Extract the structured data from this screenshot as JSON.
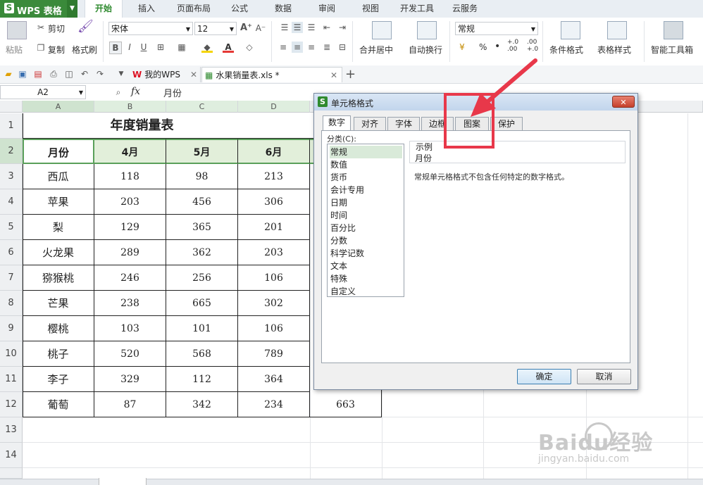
{
  "app": {
    "logo_icon": "S",
    "logo_text": "WPS 表格"
  },
  "ribbon_tabs": [
    "开始",
    "插入",
    "页面布局",
    "公式",
    "数据",
    "审阅",
    "视图",
    "开发工具",
    "云服务"
  ],
  "ribbon": {
    "paste": "粘贴",
    "cut": "剪切",
    "copy": "复制",
    "format_painter": "格式刷",
    "font_name": "宋体",
    "font_size": "12",
    "bold": "B",
    "italic": "I",
    "underline": "U",
    "merge_center": "合并居中",
    "wrap_text": "自动换行",
    "number_format": "常规",
    "percent": "%",
    "comma": "•",
    "inc_decimal": "+.0 .00",
    "dec_decimal": ".00 +.0",
    "conditional_format": "条件格式",
    "table_style": "表格样式",
    "smart_toolbox": "智能工具箱"
  },
  "doc_tabs": [
    {
      "label": "我的WPS"
    },
    {
      "label": "水果销量表.xls *"
    }
  ],
  "formula_bar": {
    "cell_ref": "A2",
    "fx": "fx",
    "value": "月份"
  },
  "sheet": {
    "columns": [
      "A",
      "B",
      "C",
      "D"
    ],
    "row_numbers": [
      "1",
      "2",
      "3",
      "4",
      "5",
      "6",
      "7",
      "8",
      "9",
      "10",
      "11",
      "12",
      "13",
      "14"
    ],
    "title": "年度销量表",
    "headers": [
      "月份",
      "4月",
      "5月",
      "6月"
    ],
    "rows": [
      [
        "西瓜",
        "118",
        "98",
        "213"
      ],
      [
        "苹果",
        "203",
        "456",
        "306"
      ],
      [
        "梨",
        "129",
        "365",
        "201"
      ],
      [
        "火龙果",
        "289",
        "362",
        "203"
      ],
      [
        "猕猴桃",
        "246",
        "256",
        "106"
      ],
      [
        "芒果",
        "238",
        "665",
        "302"
      ],
      [
        "樱桃",
        "103",
        "101",
        "106"
      ],
      [
        "桃子",
        "520",
        "568",
        "789"
      ],
      [
        "李子",
        "329",
        "112",
        "364"
      ],
      [
        "葡萄",
        "87",
        "342",
        "234",
        "663"
      ]
    ]
  },
  "dialog": {
    "icon": "S",
    "title": "单元格格式",
    "close": "✕",
    "tabs": [
      "数字",
      "对齐",
      "字体",
      "边框",
      "图案",
      "保护"
    ],
    "category_label": "分类(C):",
    "categories": [
      "常规",
      "数值",
      "货币",
      "会计专用",
      "日期",
      "时间",
      "百分比",
      "分数",
      "科学记数",
      "文本",
      "特殊",
      "自定义"
    ],
    "sample_label": "示例",
    "sample_value": "月份",
    "description": "常规单元格格式不包含任何特定的数字格式。",
    "ok": "确定",
    "cancel": "取消"
  },
  "watermark": {
    "brand": "Baidu经验",
    "url": "jingyan.baidu.com"
  },
  "colors": {
    "accent_green": "#2f8a2f",
    "header_fill": "#e2efda",
    "selection_green": "#5aa05a",
    "annotation_red": "#e8384a"
  }
}
